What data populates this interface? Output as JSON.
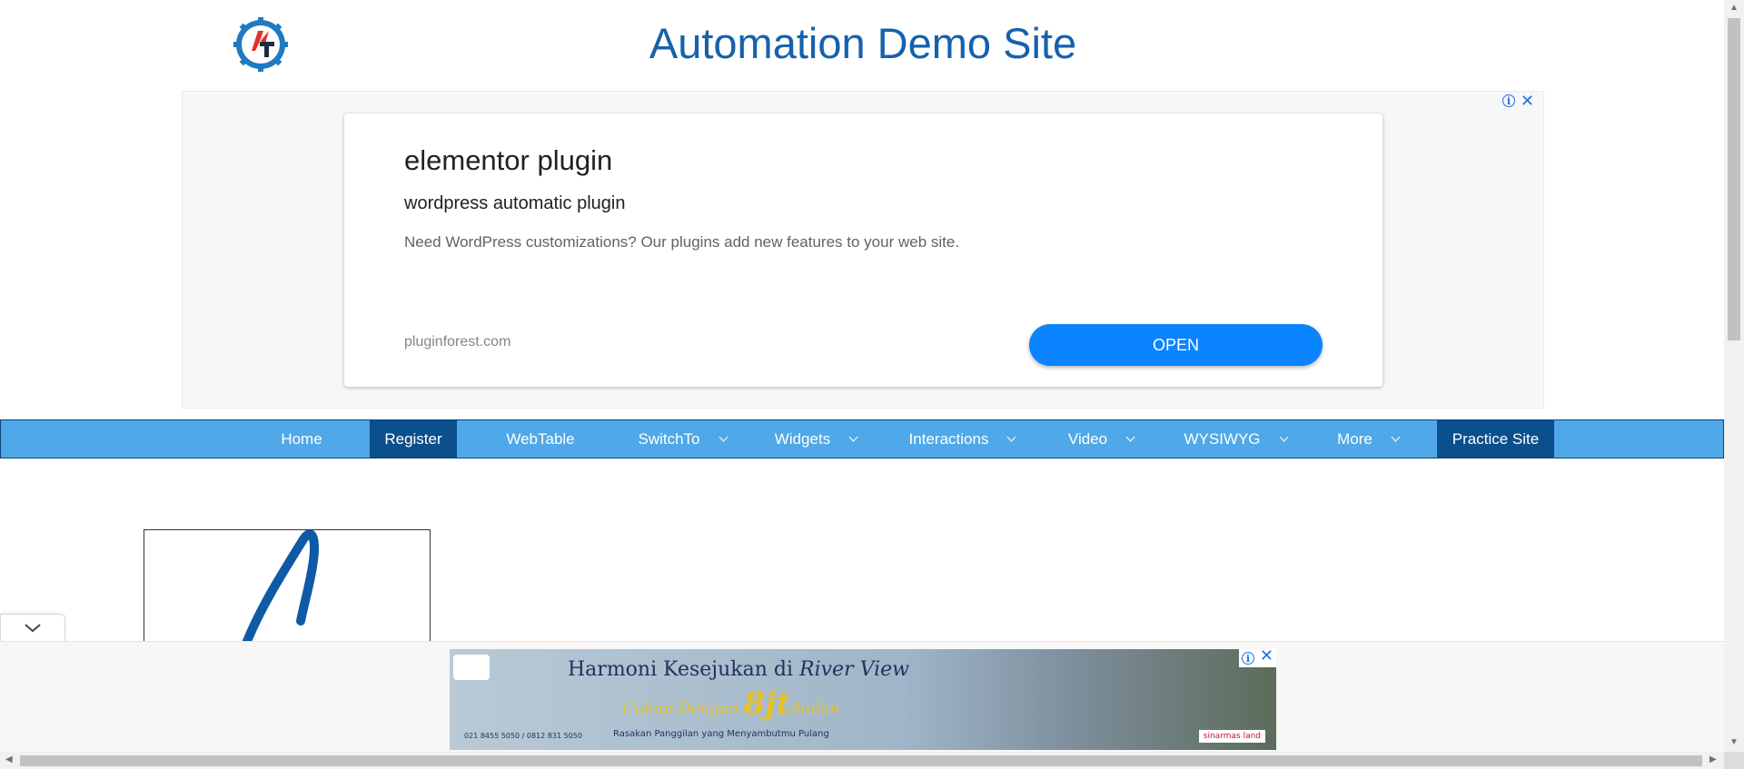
{
  "header": {
    "title": "Automation Demo Site",
    "logo_icon": "automation-gear-logo-icon",
    "brand_colors": {
      "title": "#1561ad",
      "gear": "#1f7ac0",
      "accent": "#e0312c"
    }
  },
  "top_ad": {
    "title": "elementor plugin",
    "subtitle": "wordpress automatic plugin",
    "description": "Need WordPress customizations? Our plugins add new features to your web site.",
    "domain": "pluginforest.com",
    "cta": "OPEN",
    "cta_color": "#0a84ff",
    "icons": [
      "adchoices-info-icon",
      "close-icon"
    ]
  },
  "nav": {
    "background": "#4fa8e8",
    "active_background": "#0b4f8c",
    "items": [
      {
        "label": "Home",
        "dropdown": false,
        "active": false
      },
      {
        "label": "Register",
        "dropdown": false,
        "active": true
      },
      {
        "label": "WebTable",
        "dropdown": false,
        "active": false
      },
      {
        "label": "SwitchTo",
        "dropdown": true,
        "active": false
      },
      {
        "label": "Widgets",
        "dropdown": true,
        "active": false
      },
      {
        "label": "Interactions",
        "dropdown": true,
        "active": false
      },
      {
        "label": "Video",
        "dropdown": true,
        "active": false
      },
      {
        "label": "WYSIWYG",
        "dropdown": true,
        "active": false
      },
      {
        "label": "More",
        "dropdown": true,
        "active": false
      },
      {
        "label": "Practice Site",
        "dropdown": false,
        "active": true
      }
    ]
  },
  "bottom_ad": {
    "headline_prefix": "Harmoni Kesejukan di ",
    "headline_emph": "River View",
    "offer_prefix": "Cukup Dengan ",
    "offer_amount": "8jt",
    "offer_suffix": "/bulan",
    "tagline": "Rasakan Panggilan yang Menyambutmu Pulang",
    "phone": "021 8455 5050 / 0812 831 5050",
    "brand": "sinarmas land",
    "icons": [
      "adchoices-info-icon",
      "close-icon"
    ]
  }
}
